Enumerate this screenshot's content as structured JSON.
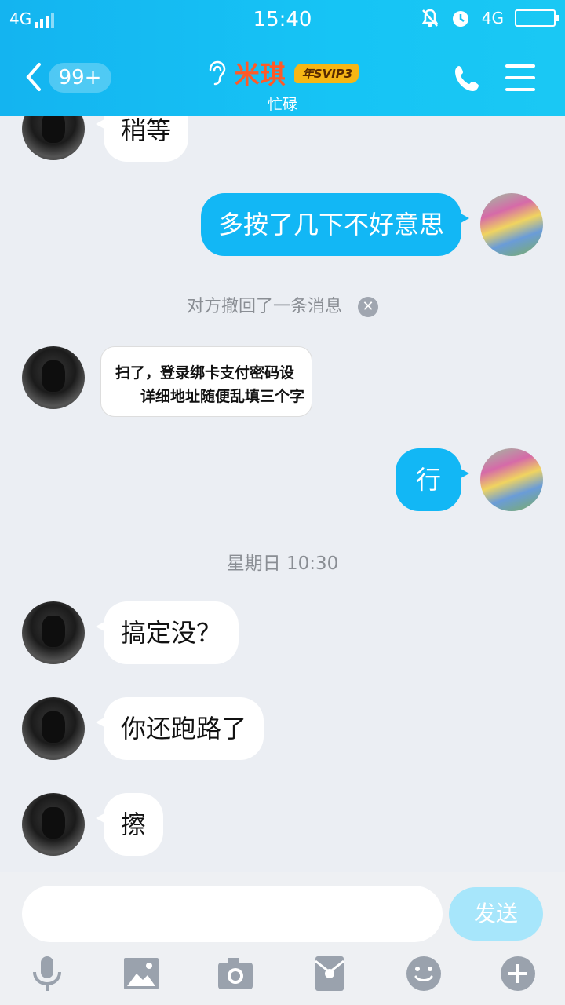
{
  "status_bar": {
    "network": "4G",
    "time": "15:40",
    "network_right": "4G"
  },
  "header": {
    "back_badge": "99+",
    "contact_name": "米琪",
    "vip_badge": "年SVIP3",
    "contact_status": "忙碌"
  },
  "messages": [
    {
      "side": "left",
      "text": "稍等"
    },
    {
      "side": "right",
      "text": "多按了几下不好意思"
    },
    {
      "type": "system",
      "text": "对方撤回了一条消息",
      "close_icon": "close-icon"
    },
    {
      "side": "left",
      "type": "image",
      "image_lines": [
        "扫了，登录绑卡支付密码设",
        "详细地址随便乱填三个字"
      ]
    },
    {
      "side": "right",
      "text": "行"
    },
    {
      "type": "time",
      "text": "星期日 10:30"
    },
    {
      "side": "left",
      "text": "搞定没？"
    },
    {
      "side": "left",
      "text": "你还跑路了"
    },
    {
      "side": "left",
      "text": "擦"
    }
  ],
  "input": {
    "value": "",
    "send_label": "发送"
  },
  "toolbar_icons": [
    "microphone-icon",
    "image-icon",
    "camera-icon",
    "red-packet-icon",
    "emoji-icon",
    "plus-icon"
  ],
  "colors": {
    "header": "#16c4f5",
    "outgoing_bubble": "#12b7f5",
    "contact_name": "#ff5a27",
    "send_button": "#a7e6fb"
  }
}
